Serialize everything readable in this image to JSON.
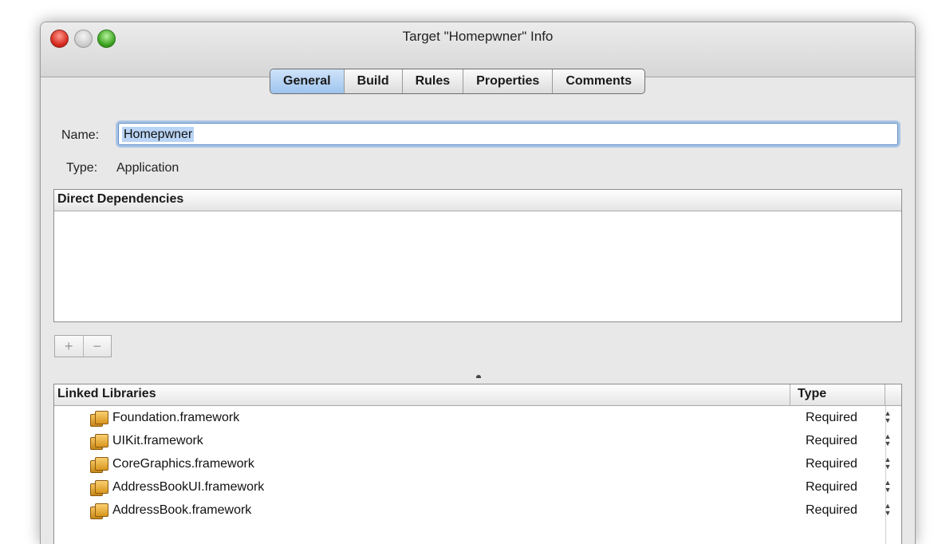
{
  "window": {
    "title": "Target \"Homepwner\" Info"
  },
  "tabs": [
    {
      "label": "General",
      "active": true
    },
    {
      "label": "Build",
      "active": false
    },
    {
      "label": "Rules",
      "active": false
    },
    {
      "label": "Properties",
      "active": false
    },
    {
      "label": "Comments",
      "active": false
    }
  ],
  "general": {
    "name_label": "Name:",
    "name_value": "Homepwner",
    "type_label": "Type:",
    "type_value": "Application"
  },
  "dependencies": {
    "header": "Direct Dependencies",
    "add_label": "+",
    "remove_label": "−"
  },
  "libraries": {
    "header": "Linked Libraries",
    "type_header": "Type",
    "items": [
      {
        "name": "Foundation.framework",
        "type": "Required",
        "icon": "framework-icon"
      },
      {
        "name": "UIKit.framework",
        "type": "Required",
        "icon": "framework-icon"
      },
      {
        "name": "CoreGraphics.framework",
        "type": "Required",
        "icon": "framework-icon"
      },
      {
        "name": "AddressBookUI.framework",
        "type": "Required",
        "icon": "framework-icon"
      },
      {
        "name": "AddressBook.framework",
        "type": "Required",
        "icon": "framework-icon"
      }
    ]
  },
  "colors": {
    "active_tab": "#9ec4ee",
    "focus_ring": "#5b8cc8"
  }
}
